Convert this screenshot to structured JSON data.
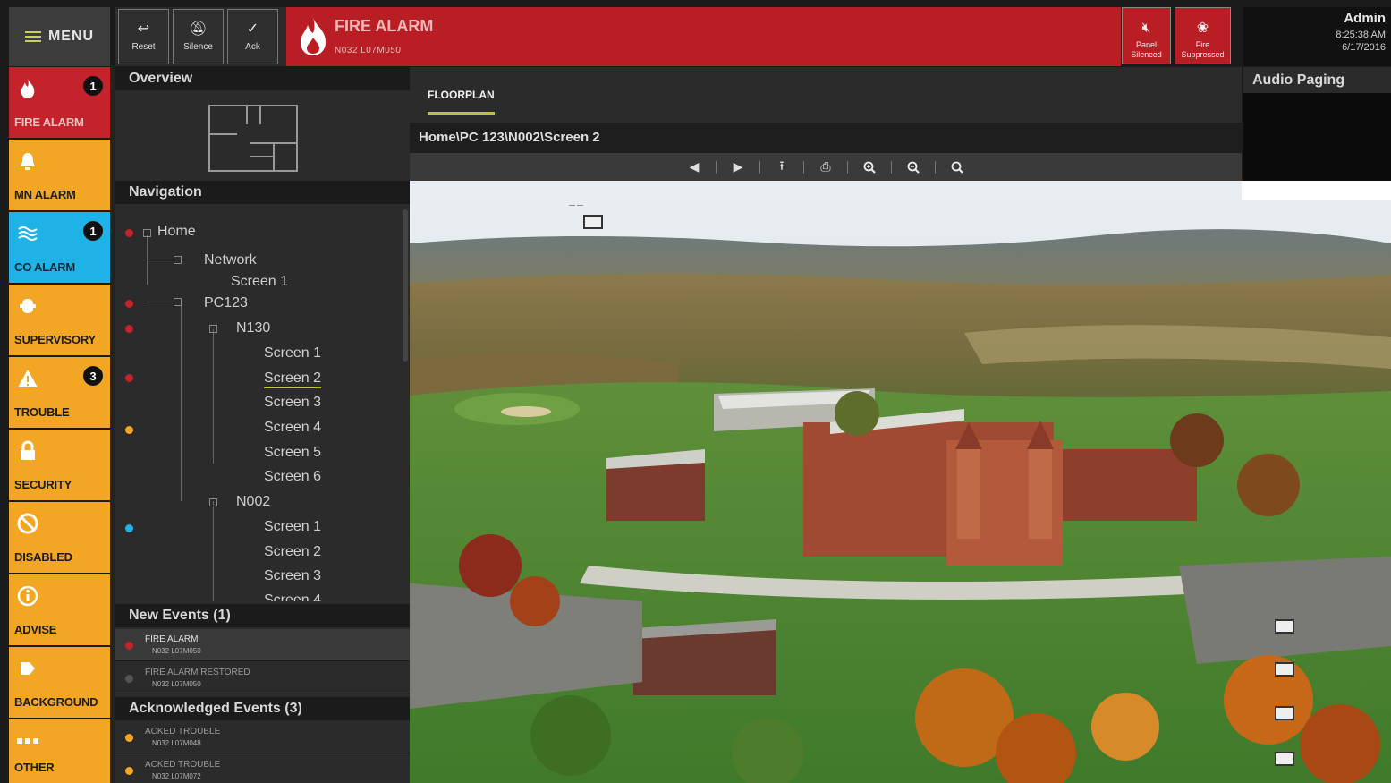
{
  "menu": {
    "label": "MENU"
  },
  "toolbar": {
    "buttons": [
      {
        "label": "Reset",
        "icon": "reset-icon"
      },
      {
        "label": "Silence",
        "icon": "silence-icon"
      },
      {
        "label": "Ack",
        "icon": "check-icon"
      }
    ]
  },
  "alarm": {
    "title": "FIRE ALARM",
    "subtitle": "N032 L07M050",
    "icon": "flame-icon"
  },
  "status": [
    {
      "label_1": "Panel",
      "label_2": "Silenced",
      "icon": "speaker-muted-icon"
    },
    {
      "label_1": "Fire",
      "label_2": "Suppressed",
      "icon": "fire-suppressed-icon"
    }
  ],
  "user": {
    "name": "Admin",
    "time": "8:25:38 AM",
    "date": "6/17/2016"
  },
  "categories": [
    {
      "label": "FIRE ALARM",
      "badge": "1",
      "icon": "flame-icon",
      "color": "#c4232b"
    },
    {
      "label": "MN ALARM",
      "badge": "",
      "icon": "bell-icon",
      "color": "#f2a624"
    },
    {
      "label": "CO ALARM",
      "badge": "1",
      "icon": "gas-icon",
      "color": "#1fb2e6"
    },
    {
      "label": "SUPERVISORY",
      "badge": "",
      "icon": "valve-icon",
      "color": "#f2a624"
    },
    {
      "label": "TROUBLE",
      "badge": "3",
      "icon": "warning-icon",
      "color": "#f2a624"
    },
    {
      "label": "SECURITY",
      "badge": "",
      "icon": "lock-icon",
      "color": "#f2a624"
    },
    {
      "label": "DISABLED",
      "badge": "",
      "icon": "disabled-icon",
      "color": "#f2a624"
    },
    {
      "label": "ADVISE",
      "badge": "",
      "icon": "info-icon",
      "color": "#f2a624"
    },
    {
      "label": "BACKGROUND",
      "badge": "",
      "icon": "background-icon",
      "color": "#f2a624"
    },
    {
      "label": "OTHER",
      "badge": "",
      "icon": "more-icon",
      "color": "#f2a624"
    }
  ],
  "overview": {
    "title": "Overview"
  },
  "navigation": {
    "title": "Navigation",
    "nodes": [
      "Home",
      "Network",
      "Screen 1",
      "PC123",
      "N130",
      "Screen 1",
      "Screen 2",
      "Screen 3",
      "Screen 4",
      "Screen 5",
      "Screen 6",
      "N002",
      "Screen 1",
      "Screen 2",
      "Screen 3",
      "Screen 4"
    ]
  },
  "new_events": {
    "title": "New Events (1)",
    "items": [
      {
        "title": "FIRE ALARM",
        "sub": "N032 L07M050"
      },
      {
        "title": "FIRE ALARM RESTORED",
        "sub": "N032 L07M050"
      }
    ]
  },
  "ack_events": {
    "title": "Acknowledged Events (3)",
    "items": [
      {
        "title": "ACKED TROUBLE",
        "sub": "N032 L07M048"
      },
      {
        "title": "ACKED TROUBLE",
        "sub": "N032 L07M072"
      }
    ]
  },
  "floorplan": {
    "tab": "FLOORPLAN",
    "breadcrumb": "Home\\PC 123\\N002\\Screen 2",
    "tools": [
      "back-icon",
      "forward-icon",
      "up-icon",
      "print-icon",
      "zoom-in-icon",
      "zoom-out-icon",
      "zoom-fit-icon"
    ]
  },
  "audio": {
    "title": "Audio Paging"
  },
  "colors": {
    "fire": "#c4232b",
    "amber": "#f2a624",
    "co": "#1fb2e6",
    "accent": "#b8c43a"
  }
}
